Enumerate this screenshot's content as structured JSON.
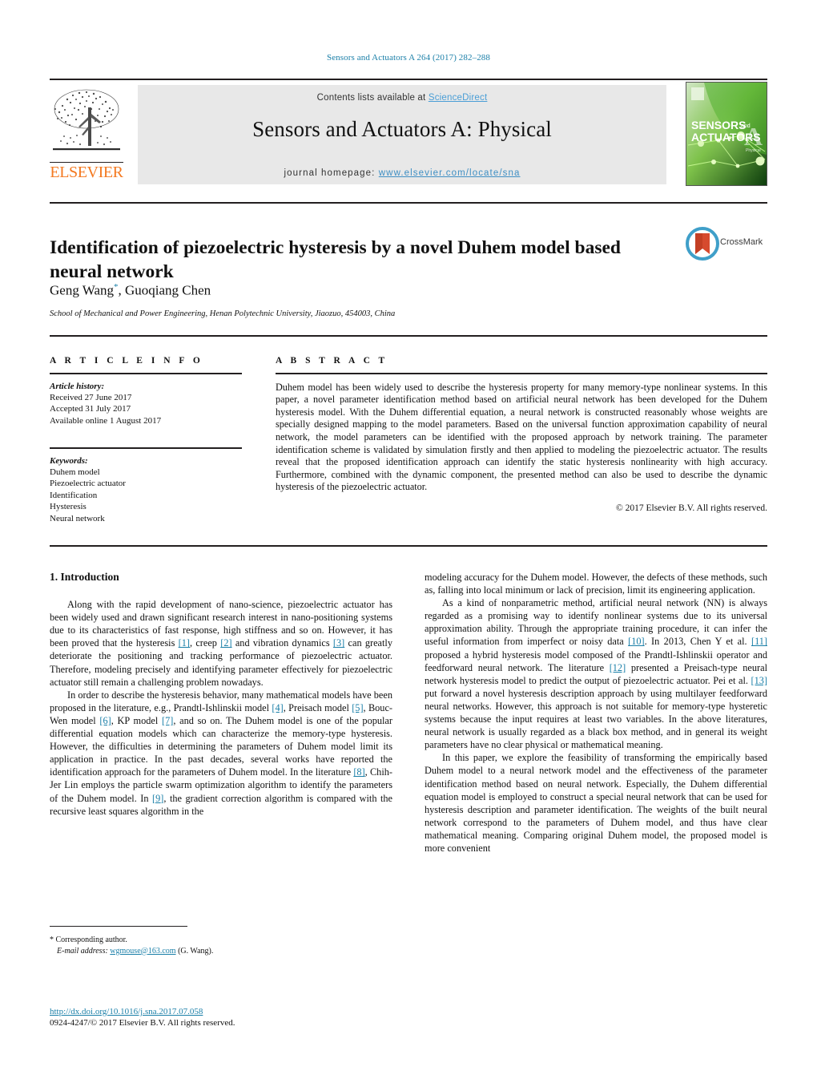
{
  "running_head": "Sensors and Actuators A 264 (2017) 282–288",
  "masthead": {
    "contents_prefix": "Contents lists available at ",
    "sciencedirect": "ScienceDirect",
    "journal_title": "Sensors and Actuators A: Physical",
    "homepage_prefix": "journal homepage: ",
    "homepage_url": "www.elsevier.com/locate/sna",
    "publisher_wordmark": "ELSEVIER",
    "cover_line1": "SENSORS",
    "cover_and": "and",
    "cover_line2": "ACTUATORS",
    "cover_letter": "A",
    "cover_sub": "Physical"
  },
  "title": "Identification of piezoelectric hysteresis by a novel Duhem model based neural network",
  "crossmark_label": "CrossMark",
  "authors": "Geng Wang",
  "authors_rest": ", Guoqiang Chen",
  "author_marker": "*",
  "affiliation": "School of Mechanical and Power Engineering, Henan Polytechnic University, Jiaozuo, 454003, China",
  "article_info": {
    "heading": "A R T I C L E    I N F O",
    "history_label": "Article history:",
    "history": [
      "Received 27 June 2017",
      "Accepted 31 July 2017",
      "Available online 1 August 2017"
    ],
    "keywords_label": "Keywords:",
    "keywords": [
      "Duhem model",
      "Piezoelectric actuator",
      "Identification",
      "Hysteresis",
      "Neural network"
    ]
  },
  "abstract": {
    "heading": "A B S T R A C T",
    "text": "Duhem model has been widely used to describe the hysteresis property for many memory-type nonlinear systems. In this paper, a novel parameter identification method based on artificial neural network has been developed for the Duhem hysteresis model. With the Duhem differential equation, a neural network is constructed reasonably whose weights are specially designed mapping to the model parameters. Based on the universal function approximation capability of neural network, the model parameters can be identified with the proposed approach by network training. The parameter identification scheme is validated by simulation firstly and then applied to modeling the piezoelectric actuator. The results reveal that the proposed identification approach can identify the static hysteresis nonlinearity with high accuracy. Furthermore, combined with the dynamic component, the presented method can also be used to describe the dynamic hysteresis of the piezoelectric actuator.",
    "copyright": "© 2017 Elsevier B.V. All rights reserved."
  },
  "body": {
    "section_heading": "1.  Introduction",
    "left_paragraphs": [
      {
        "segments": [
          {
            "t": "Along with the rapid development of nano-science, piezoelectric actuator has been widely used and drawn significant research interest in nano-positioning systems due to its characteristics of fast response, high stiffness and so on. However, it has been proved that the hysteresis "
          },
          {
            "t": "[1]",
            "cite": true
          },
          {
            "t": ", creep "
          },
          {
            "t": "[2]",
            "cite": true
          },
          {
            "t": " and vibration dynamics "
          },
          {
            "t": "[3]",
            "cite": true
          },
          {
            "t": " can greatly deteriorate the positioning and tracking performance of piezoelectric actuator. Therefore, modeling precisely and identifying parameter effectively for piezoelectric actuator still remain a challenging problem nowadays."
          }
        ]
      },
      {
        "segments": [
          {
            "t": "In order to describe the hysteresis behavior, many mathematical models have been proposed in the literature, e.g., Prandtl-Ishlinskii model "
          },
          {
            "t": "[4]",
            "cite": true
          },
          {
            "t": ", Preisach model "
          },
          {
            "t": "[5]",
            "cite": true
          },
          {
            "t": ", Bouc-Wen model "
          },
          {
            "t": "[6]",
            "cite": true
          },
          {
            "t": ", KP model "
          },
          {
            "t": "[7]",
            "cite": true
          },
          {
            "t": ", and so on. The Duhem model is one of the popular differential equation models which can characterize the memory-type hysteresis. However, the difficulties in determining the parameters of Duhem model limit its application in practice. In the past decades, several works have reported the identification approach for the parameters of Duhem model. In the literature "
          },
          {
            "t": "[8]",
            "cite": true
          },
          {
            "t": ", Chih-Jer Lin employs the particle swarm optimization algorithm to identify the parameters of the Duhem model. In "
          },
          {
            "t": "[9]",
            "cite": true
          },
          {
            "t": ", the gradient correction algorithm is compared with the recursive least squares algorithm in the"
          }
        ]
      }
    ],
    "right_paragraphs": [
      {
        "no_indent": true,
        "segments": [
          {
            "t": "modeling accuracy for the Duhem model. However, the defects of these methods, such as, falling into local minimum or lack of precision, limit its engineering application."
          }
        ]
      },
      {
        "segments": [
          {
            "t": "As a kind of nonparametric method, artificial neural network (NN) is always regarded as a promising way to identify nonlinear systems due to its universal approximation ability. Through the appropriate training procedure, it can infer the useful information from imperfect or noisy data "
          },
          {
            "t": "[10]",
            "cite": true
          },
          {
            "t": ". In 2013, Chen Y et al. "
          },
          {
            "t": "[11]",
            "cite": true
          },
          {
            "t": " proposed a hybrid hysteresis model composed of the Prandtl-Ishlinskii operator and feedforward neural network. The literature "
          },
          {
            "t": "[12]",
            "cite": true
          },
          {
            "t": " presented a Preisach-type neural network hysteresis model to predict the output of piezoelectric actuator. Pei et al. "
          },
          {
            "t": "[13]",
            "cite": true
          },
          {
            "t": " put forward a novel hysteresis description approach by using multilayer feedforward neural networks. However, this approach is not suitable for memory-type hysteretic systems because the input requires at least two variables. In the above literatures, neural network is usually regarded as a black box method, and in general its weight parameters have no clear physical or mathematical meaning."
          }
        ]
      },
      {
        "segments": [
          {
            "t": "In this paper, we explore the feasibility of transforming the empirically based Duhem model to a neural network model and the effectiveness of the parameter identification method based on neural network. Especially, the Duhem differential equation model is employed to construct a special neural network that can be used for hysteresis description and parameter identification. The weights of the built neural network correspond to the parameters of Duhem model, and thus have clear mathematical meaning. Comparing original Duhem model, the proposed model is more convenient"
          }
        ]
      }
    ]
  },
  "footnote": {
    "marker": "*",
    "corresponding": "Corresponding author.",
    "email_label": "E-mail address:",
    "email": "wgmouse@163.com",
    "email_suffix": "(G. Wang)."
  },
  "footer": {
    "doi": "http://dx.doi.org/10.1016/j.sna.2017.07.058",
    "issn_line": "0924-4247/© 2017 Elsevier B.V. All rights reserved."
  },
  "colors": {
    "link_blue": "#1a7fa8",
    "sciencedirect_blue": "#4a9ed6",
    "elsevier_orange": "#f47920",
    "masthead_gray": "#e8e8e8"
  }
}
